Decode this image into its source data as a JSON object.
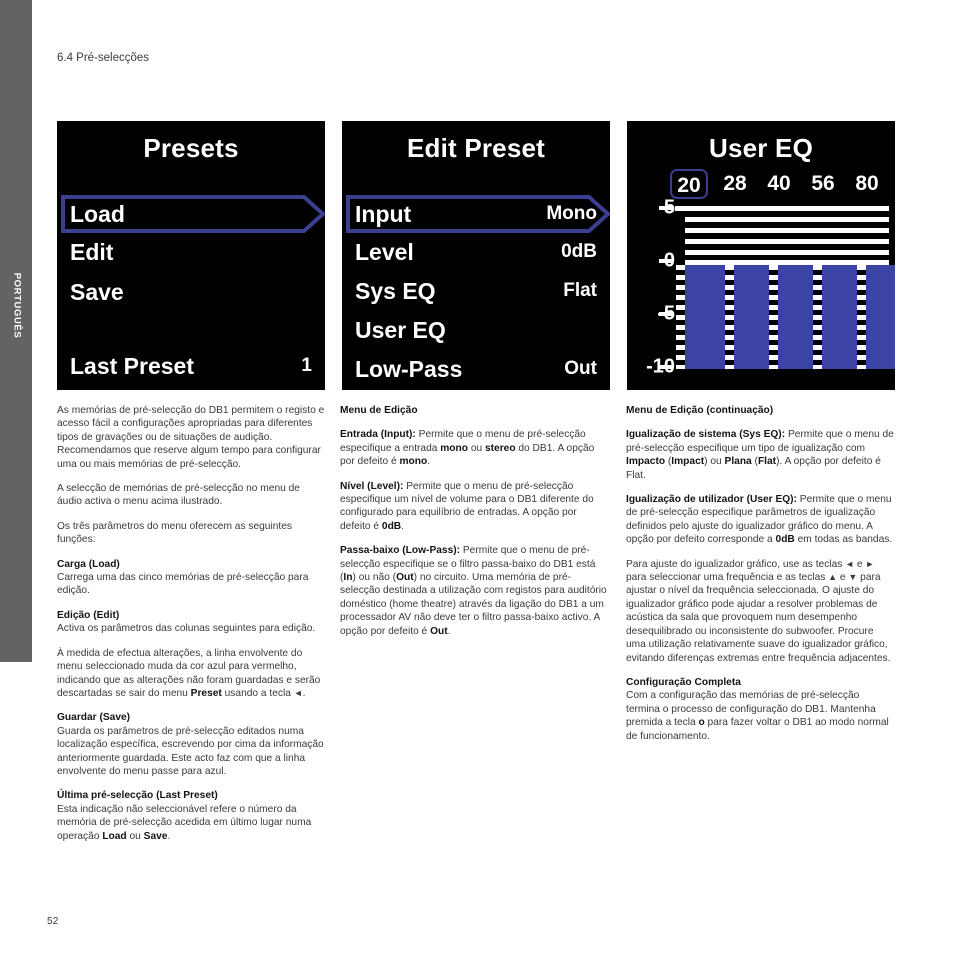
{
  "section": {
    "heading": "6.4 Pré-selecções"
  },
  "sidebar": {
    "language": "PORTUGUÊS"
  },
  "page": {
    "number": "52"
  },
  "panels": [
    {
      "id": "presets",
      "title": "Presets",
      "rows": [
        {
          "label": "Load",
          "value": "",
          "selected": true
        },
        {
          "label": "Edit",
          "value": "",
          "selected": false
        },
        {
          "label": "Save",
          "value": "",
          "selected": false
        },
        {
          "label": "Last Preset",
          "value": "1",
          "selected": false
        }
      ]
    },
    {
      "id": "edit-preset",
      "title": "Edit Preset",
      "rows": [
        {
          "label": "Input",
          "value": "Mono",
          "selected": true
        },
        {
          "label": "Level",
          "value": "0dB",
          "selected": false
        },
        {
          "label": "Sys EQ",
          "value": "Flat",
          "selected": false
        },
        {
          "label": "User EQ",
          "value": "",
          "selected": false
        },
        {
          "label": "Low-Pass",
          "value": "Out",
          "selected": false
        }
      ]
    },
    {
      "id": "user-eq",
      "title": "User EQ"
    }
  ],
  "chart_data": {
    "type": "bar",
    "title": "User EQ",
    "categories": [
      "20",
      "28",
      "40",
      "56",
      "80"
    ],
    "values": [
      0,
      0,
      0,
      0,
      0
    ],
    "selected_category": "20",
    "xlabel": "",
    "ylabel": "",
    "ylim": [
      -10,
      5
    ],
    "yticks": [
      "5",
      "0",
      "-5",
      "-10"
    ],
    "ytick_values": [
      5,
      0,
      -5,
      -10
    ],
    "grid": true,
    "legend": "none",
    "bar_color": "#3b43a5",
    "accent_color": "#3b3f8f"
  },
  "col1": {
    "p1": "As memórias de pré-selecção do DB1 permitem o registo e acesso fácil a configurações apropriadas para diferentes tipos de gravações ou de situações de audição. Recomendamos que reserve algum tempo para configurar uma ou mais memórias de pré-selecção.",
    "p2": "A selecção de memórias de pré-selecção no menu de áudio activa o menu acima ilustrado.",
    "p3": "Os três parâmetros do menu oferecem as seguintes funções:",
    "h1": "Carga (Load)",
    "p4": "Carrega uma das cinco memórias de pré-selecção para edição.",
    "h2": "Edição (Edit)",
    "p5": "Activa os parâmetros das colunas seguintes para edição.",
    "p6_a": "À medida de efectua alterações, a linha envolvente do menu seleccionado muda da cor azul para vermelho, indicando que as alterações não foram guardadas e serão descartadas se sair do menu ",
    "p6_b": "Preset",
    "p6_c": " usando a tecla ",
    "p6_glyph": "◄",
    "p6_d": ".",
    "h3": "Guardar (Save)",
    "p7": "Guarda os parâmetros de pré-selecção editados numa localização específica, escrevendo por cima da informação anteriormente guardada. Este acto faz com que a linha envolvente do menu passe para azul.",
    "h4": "Última pré-selecção (Last Preset)",
    "p8_a": "Esta indicação não seleccionável refere o número da memória de pré-selecção acedida em último lugar numa operação ",
    "p8_b": "Load",
    "p8_c": " ou ",
    "p8_d": "Save",
    "p8_e": "."
  },
  "col2": {
    "h1": "Menu de Edição",
    "p1_a": "Entrada (Input):",
    "p1_b": " Permite que o menu de pré-selecção especifique a entrada ",
    "p1_c": "mono",
    "p1_d": " ou ",
    "p1_e": "stereo",
    "p1_f": " do DB1. A opção por defeito é ",
    "p1_g": "mono",
    "p1_h": ".",
    "p2_a": "Nível (Level):",
    "p2_b": " Permite que o menu de pré-selecção especifique um nível de volume para o DB1 diferente do configurado para equilíbrio de entradas. A opção por defeito é ",
    "p2_c": "0dB",
    "p2_d": ".",
    "p3_a": "Passa-baixo (Low-Pass):",
    "p3_b": " Permite que o menu de pré-selecção especifique se o filtro passa-baixo do DB1 está (",
    "p3_c": "In",
    "p3_d": ") ou não (",
    "p3_e": "Out",
    "p3_f": ") no circuito. Uma memória de pré-selecção destinada a utilização com registos para auditório doméstico (home theatre) através da ligação do DB1 a um processador AV não deve ter o filtro passa-baixo activo. A opção por defeito é ",
    "p3_g": "Out",
    "p3_h": "."
  },
  "col3": {
    "h1": "Menu de Edição (continuação)",
    "p1_a": "Igualização de sistema (Sys EQ):",
    "p1_b": " Permite que o menu de pré-selecção especifique um tipo de igualização com ",
    "p1_c": "Impacto",
    "p1_d": " (",
    "p1_e": "Impact",
    "p1_f": ") ou ",
    "p1_g": "Plana",
    "p1_h": " (",
    "p1_i": "Flat",
    "p1_j": "). A opção por defeito é Flat.",
    "p2_a": "Igualização de utilizador (User EQ):",
    "p2_b": " Permite que o menu de pré-selecção especifique parâmetros de igualização definidos pelo ajuste do igualizador gráfico do menu. A opção por defeito corresponde a ",
    "p2_c": "0dB",
    "p2_d": " em todas as bandas.",
    "p3_a": "Para ajuste do igualizador gráfico, use as teclas ",
    "p3_g1": "◄",
    "p3_b": " e ",
    "p3_g2": "►",
    "p3_c": " para seleccionar uma frequência e as teclas ",
    "p3_g3": "▲",
    "p3_d": " e ",
    "p3_g4": "▼",
    "p3_e": " para ajustar o nível da frequência seleccionada. O ajuste do igualizador gráfico pode ajudar a resolver problemas de acústica da sala que provoquem num desempenho desequilibrado ou inconsistente do subwoofer. Procure uma utilização relativamente suave do igualizador gráfico, evitando diferenças extremas entre frequência adjacentes.",
    "h2": "Configuração Completa",
    "p4_a": "Com a configuração das memórias de pré-selecção termina o processo de configuração do DB1. Mantenha premida a tecla ",
    "p4_glyph": "о",
    "p4_b": " para fazer voltar o DB1 ao modo normal de funcionamento."
  }
}
